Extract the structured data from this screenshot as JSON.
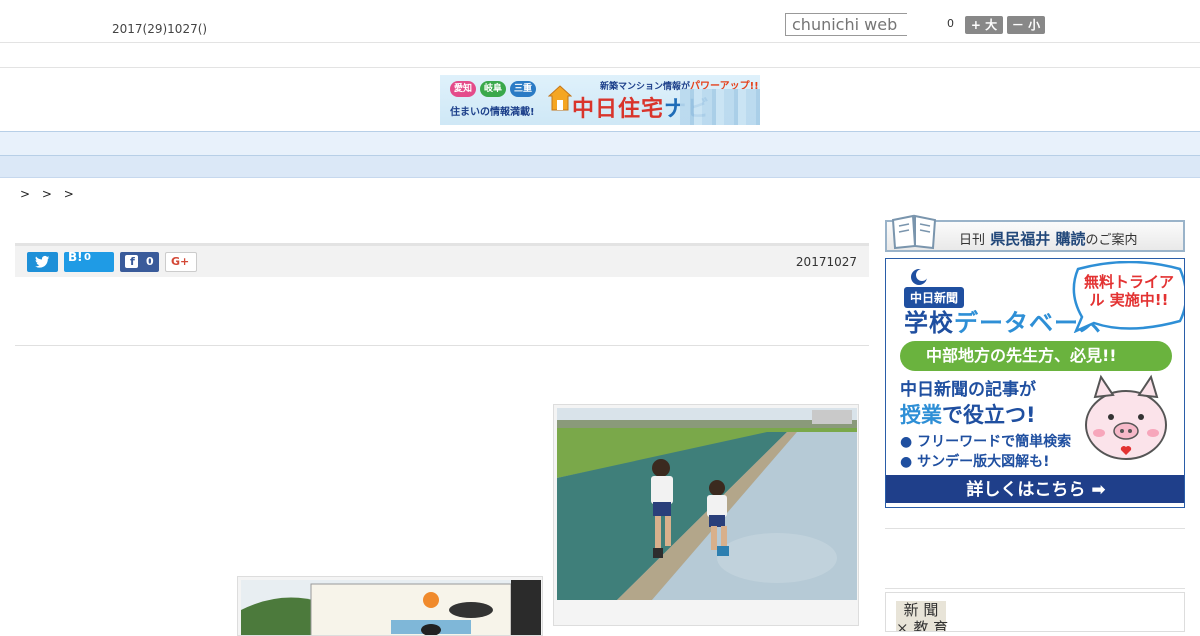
{
  "header": {
    "date": "2017(29)1027()",
    "search_placeholder": "chunichi web",
    "font_count": "0",
    "font_large": "+ 大",
    "font_small": "－ 小"
  },
  "banner": {
    "tags": [
      "愛知",
      "岐阜",
      "三重"
    ],
    "subtitle": "住まいの情報満載!",
    "top_note": "新築マンション情報が",
    "top_note_emph": "パワーアップ!!",
    "title_main": "中日住宅",
    "title_accent": "ナビ"
  },
  "nav": {
    "items": [
      "",
      "",
      "",
      "",
      "",
      "",
      "",
      "",
      ""
    ]
  },
  "breadcrumb": ">  >  >",
  "share": {
    "twitter_label": "",
    "hatena_label": "B!",
    "hatena_count": "0",
    "facebook_count": "0",
    "gplus_label": "G+",
    "date": "20171027"
  },
  "sidebar": {
    "subscribe_small": "日刊",
    "subscribe_title": "県民福井 購読",
    "subscribe_suffix": "のご案内",
    "ad": {
      "brand_tag": "中日新聞",
      "brand_main": "学校",
      "brand_accent": "データベース",
      "trial": "無料トライアル 実施中!!",
      "green": "中部地方の先生方、必見!!",
      "line1": "中日新聞の記事が",
      "line2_accent": "授業",
      "line2_rest": "で役立つ!",
      "bullet1": "● フリーワードで簡単検索",
      "bullet2": "● サンデー版大図解も!",
      "cta": "詳しくはこちら ➡"
    },
    "logo_text": "新 聞\n× 教 育"
  },
  "colors": {
    "nav_bg": "#e8f1fb",
    "share_bg": "#f2f2f2",
    "twitter": "#1e90d8",
    "hatena": "#1f9be5",
    "facebook": "#3a5b9a",
    "ad_blue": "#1f4fa0",
    "ad_green": "#6ab33e"
  }
}
